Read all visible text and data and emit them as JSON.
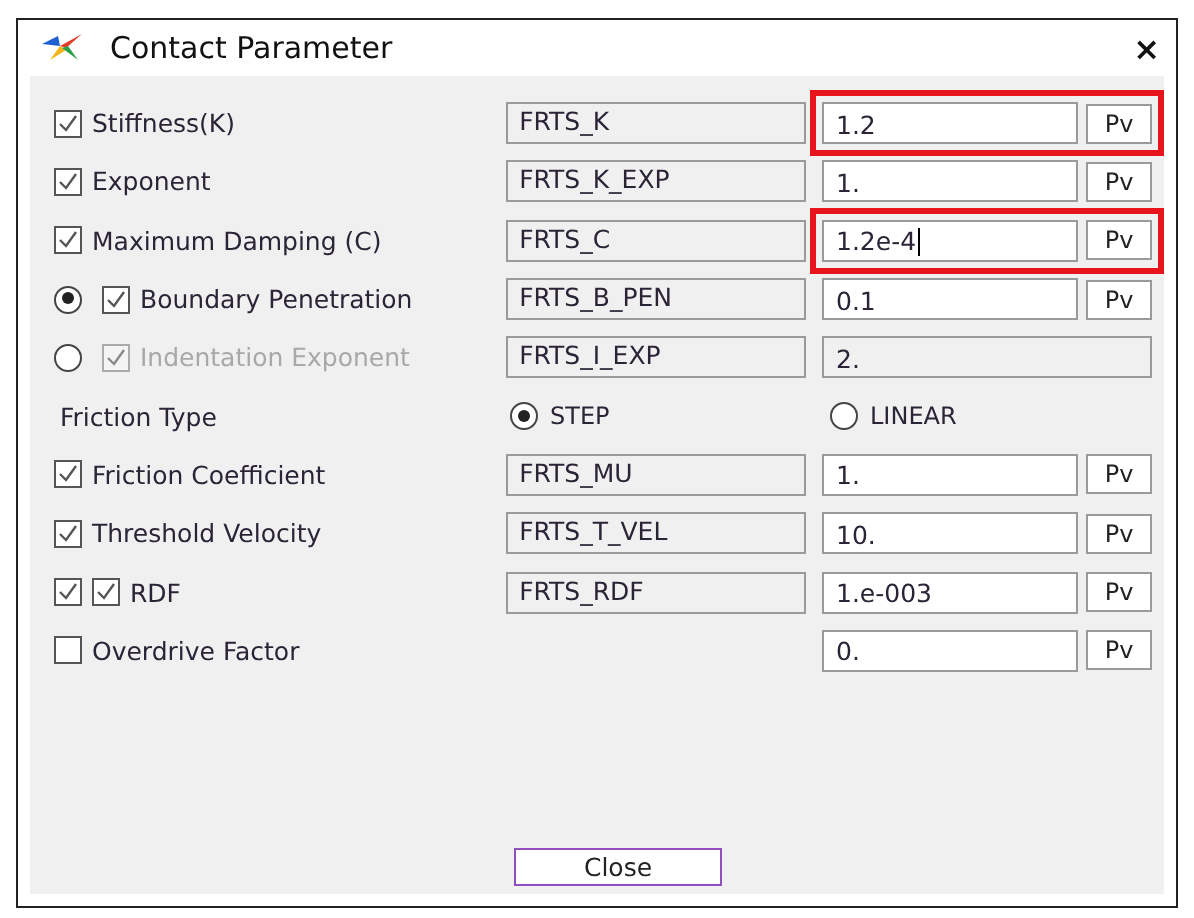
{
  "window": {
    "title": "Contact Parameter",
    "close": "×"
  },
  "rows": [
    {
      "kind": "param",
      "checked": true,
      "label": "Stiffness(K)",
      "variable": "FRTS_K",
      "value": "1.2",
      "button": "Pv",
      "highlighted": true,
      "disabled": false
    },
    {
      "kind": "param",
      "checked": true,
      "label": "Exponent",
      "variable": "FRTS_K_EXP",
      "value": "1.",
      "button": "Pv",
      "highlighted": false,
      "disabled": false
    },
    {
      "kind": "param",
      "checked": true,
      "label": "Maximum Damping (C)",
      "variable": "FRTS_C",
      "value": "1.2e-4",
      "button": "Pv",
      "highlighted": true,
      "disabled": false,
      "cursor": true
    },
    {
      "kind": "param",
      "radio": {
        "selected": true
      },
      "checked": true,
      "label": "Boundary Penetration",
      "variable": "FRTS_B_PEN",
      "value": "0.1",
      "button": "Pv",
      "highlighted": false,
      "disabled": false
    },
    {
      "kind": "param",
      "radio": {
        "selected": false
      },
      "checked": true,
      "label": "Indentation Exponent",
      "variable": "FRTS_I_EXP",
      "value": "2.",
      "highlighted": false,
      "disabled": true
    },
    {
      "kind": "choice",
      "label": "Friction Type",
      "options": [
        {
          "label": "STEP",
          "selected": true
        },
        {
          "label": "LINEAR",
          "selected": false
        }
      ]
    },
    {
      "kind": "param",
      "checked": true,
      "label": "Friction Coefficient",
      "variable": "FRTS_MU",
      "value": "1.",
      "button": "Pv",
      "highlighted": false,
      "disabled": false
    },
    {
      "kind": "param",
      "checked": true,
      "label": "Threshold Velocity",
      "variable": "FRTS_T_VEL",
      "value": "10.",
      "button": "Pv",
      "highlighted": false,
      "disabled": false
    },
    {
      "kind": "param",
      "pre_checked": true,
      "checked": true,
      "label": "RDF",
      "variable": "FRTS_RDF",
      "value": "1.e-003",
      "button": "Pv",
      "highlighted": false,
      "disabled": false
    },
    {
      "kind": "param",
      "checked": false,
      "label": "Overdrive Factor",
      "value": "0.",
      "button": "Pv",
      "highlighted": false,
      "disabled": false
    }
  ],
  "close_button": "Close"
}
